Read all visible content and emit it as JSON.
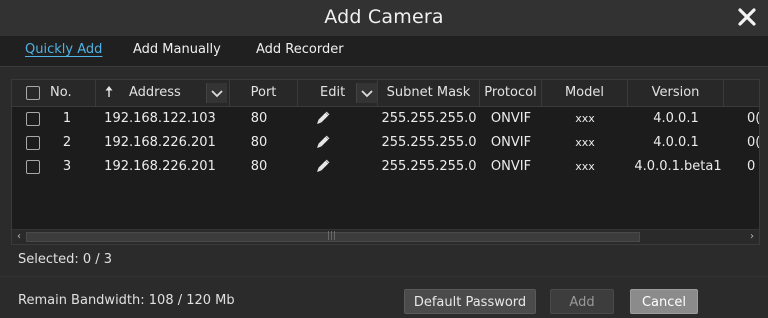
{
  "dialog": {
    "title": "Add Camera"
  },
  "tabs": [
    {
      "label": "Quickly Add",
      "active": true
    },
    {
      "label": "Add Manually",
      "active": false
    },
    {
      "label": "Add Recorder",
      "active": false
    }
  ],
  "table": {
    "headers": {
      "no": "No.",
      "address": "Address",
      "port": "Port",
      "edit": "Edit",
      "subnet": "Subnet Mask",
      "protocol": "Protocol",
      "model": "Model",
      "version": "Version"
    },
    "rows": [
      {
        "no": "1",
        "address": "192.168.122.103",
        "port": "80",
        "subnet": "255.255.255.0",
        "protocol": "ONVIF",
        "model": "xxx",
        "version": "4.0.0.1",
        "extra": "0("
      },
      {
        "no": "2",
        "address": "192.168.226.201",
        "port": "80",
        "subnet": "255.255.255.0",
        "protocol": "ONVIF",
        "model": "xxx",
        "version": "4.0.0.1",
        "extra": "0("
      },
      {
        "no": "3",
        "address": "192.168.226.201",
        "port": "80",
        "subnet": "255.255.255.0",
        "protocol": "ONVIF",
        "model": "xxx",
        "version": "4.0.0.1.beta1",
        "extra": "0"
      }
    ]
  },
  "status": {
    "selected": "Selected: 0 / 3",
    "bandwidth": "Remain Bandwidth: 108 / 120 Mb"
  },
  "buttons": {
    "default_password": "Default Password",
    "add": "Add",
    "cancel": "Cancel"
  },
  "icons": {
    "close": "close-icon",
    "sort": "sort-up-arrow-icon",
    "dropdown": "chevron-down-icon",
    "edit": "pencil-icon"
  },
  "colors": {
    "accent": "#4fb3e6",
    "background": "#2b2b2b"
  }
}
